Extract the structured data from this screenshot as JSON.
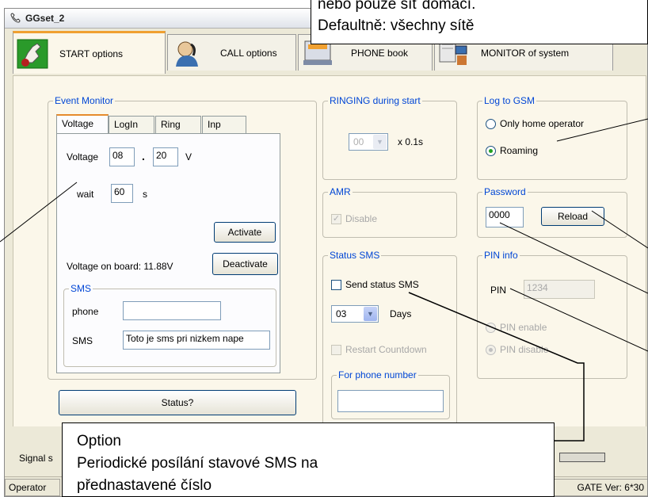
{
  "window": {
    "title": "GGset_2"
  },
  "tabs": [
    {
      "label": "START options",
      "icon": "hand-pointer-icon"
    },
    {
      "label": "CALL options",
      "icon": "phone-call-icon"
    },
    {
      "label": "PHONE book",
      "icon": "phone-book-icon"
    },
    {
      "label": "MONITOR of system",
      "icon": "monitor-system-icon"
    }
  ],
  "event_monitor": {
    "title": "Event Monitor",
    "tabs": [
      "Voltage",
      "LogIn",
      "Ring",
      "Inp"
    ],
    "voltage_label": "Voltage",
    "voltage_int": "08",
    "voltage_sep": ".",
    "voltage_dec": "20",
    "voltage_unit": "V",
    "wait_label": "wait",
    "wait_value": "60",
    "wait_unit": "s",
    "activate_label": "Activate",
    "deactivate_label": "Deactivate",
    "onboard_text": "Voltage on board: 11.88V",
    "sms_group": "SMS",
    "phone_label": "phone",
    "phone_value": "",
    "sms_label": "SMS",
    "sms_value": "Toto je sms pri nizkem nape",
    "status_button": "Status?"
  },
  "ringing": {
    "title": "RINGING during start",
    "value": "00",
    "unit": "x 0.1s"
  },
  "amr": {
    "title": "AMR",
    "checkbox_label": "Disable",
    "checked": true
  },
  "status_sms": {
    "title": "Status SMS",
    "send_label": "Send status SMS",
    "days_value": "03",
    "days_label": "Days",
    "restart_label": "Restart Countdown",
    "for_phone_title": "For phone number",
    "phone_value": ""
  },
  "log_to_gsm": {
    "title": "Log to GSM",
    "opt1": "Only home operator",
    "opt2": "Roaming",
    "selected": "Roaming"
  },
  "password": {
    "title": "Password",
    "value": "0000",
    "reload_label": "Reload"
  },
  "pin_info": {
    "title": "PIN info",
    "pin_label": "PIN",
    "pin_value": "1234",
    "enable_label": "PIN enable",
    "disable_label": "PIN disable",
    "selected": "PIN disable"
  },
  "bottom": {
    "signal_label": "Signal s",
    "operator_label": "Operator",
    "version": "GATE Ver: 6*30"
  },
  "callouts": {
    "top_line1": "nebo pouze síť domácí.",
    "top_line2": "Defaultně: všechny sítě",
    "bottom_line1": "Option",
    "bottom_line2": "Periodické posílání stavové SMS na",
    "bottom_line3": "přednastavené číslo"
  },
  "colors": {
    "accent_tab": "#f0a030",
    "group_label": "#0046d5",
    "window_bg": "#ece9d8",
    "panel_bg": "#fbf7ea"
  }
}
